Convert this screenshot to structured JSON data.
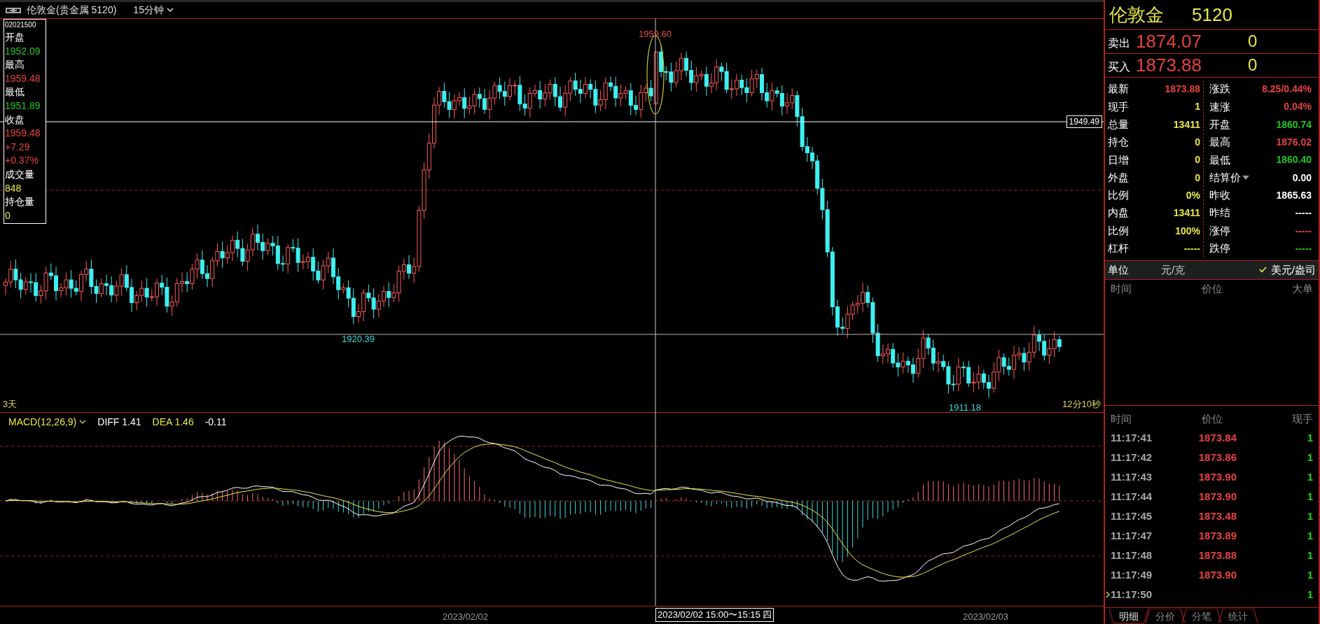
{
  "toolbar": {
    "title": "伦敦金(贵金属 5120)",
    "period": "15分钟"
  },
  "info_box": {
    "time": "02021500",
    "items": [
      {
        "text": "开盘",
        "kind": "label"
      },
      {
        "text": "1952.09",
        "kind": "value",
        "color": "#22c422"
      },
      {
        "text": "最高",
        "kind": "label"
      },
      {
        "text": "1959.48",
        "kind": "value",
        "color": "#e84040"
      },
      {
        "text": "最低",
        "kind": "label"
      },
      {
        "text": "1951.89",
        "kind": "value",
        "color": "#22c422"
      },
      {
        "text": "收盘",
        "kind": "label"
      },
      {
        "text": "1959.48",
        "kind": "value",
        "color": "#e84040"
      },
      {
        "text": "+7.29",
        "kind": "value",
        "color": "#e84040"
      },
      {
        "text": "+0.37%",
        "kind": "value",
        "color": "#e84040"
      },
      {
        "text": "成交量",
        "kind": "label"
      },
      {
        "text": "848",
        "kind": "value",
        "color": "#e8e84a"
      },
      {
        "text": "持仓量",
        "kind": "label"
      },
      {
        "text": "0",
        "kind": "value",
        "color": "#e8e84a"
      }
    ]
  },
  "chart": {
    "price_labels": [
      {
        "text": "1959.60",
        "kind": "high"
      },
      {
        "text": "1920.39",
        "kind": "low"
      },
      {
        "text": "1911.18",
        "kind": "low"
      }
    ],
    "crosshair_price": "1949.49",
    "range": "3天",
    "countdown": "12分10秒"
  },
  "macd": {
    "name": "MACD(12,26,9)",
    "diff": "DIFF 1.41",
    "dea": "DEA 1.46",
    "value": "-0.11"
  },
  "x_axis": {
    "dates": [
      "2023/02/02",
      "2023/02/03"
    ],
    "crosshair_time": "2023/02/02 15:00〜15:15 四"
  },
  "quote": {
    "name": "伦敦金",
    "code": "5120",
    "sell": {
      "label": "卖出",
      "price": "1874.07",
      "volume": "0"
    },
    "buy": {
      "label": "买入",
      "price": "1873.88",
      "volume": "0"
    },
    "stats_left": [
      {
        "label": "最新",
        "value": "1873.88",
        "color": "#e84040"
      },
      {
        "label": "现手",
        "value": "1",
        "color": "#e8e84a"
      },
      {
        "label": "总量",
        "value": "13411",
        "color": "#e8e84a"
      },
      {
        "label": "持仓",
        "value": "0",
        "color": "#e8e84a"
      },
      {
        "label": "日增",
        "value": "0",
        "color": "#e8e84a"
      },
      {
        "label": "外盘",
        "value": "0",
        "color": "#e8e84a"
      },
      {
        "label": "比例",
        "value": "0%",
        "color": "#e8e84a"
      },
      {
        "label": "内盘",
        "value": "13411",
        "color": "#e8e84a"
      },
      {
        "label": "比例",
        "value": "100%",
        "color": "#e8e84a"
      },
      {
        "label": "杠杆",
        "value": "-----",
        "color": "#e8e84a"
      }
    ],
    "stats_right": [
      {
        "label": "涨跌",
        "value": "8.25/0.44%",
        "color": "#e84040",
        "menu": false
      },
      {
        "label": "速涨",
        "value": "0.04%",
        "color": "#e84040",
        "menu": false
      },
      {
        "label": "开盘",
        "value": "1860.74",
        "color": "#22c422",
        "menu": false
      },
      {
        "label": "最高",
        "value": "1876.02",
        "color": "#e84040",
        "menu": false
      },
      {
        "label": "最低",
        "value": "1860.40",
        "color": "#22c422",
        "menu": false
      },
      {
        "label": "结算价",
        "value": "0.00",
        "color": "#ffffff",
        "menu": true
      },
      {
        "label": "昨收",
        "value": "1865.63",
        "color": "#ffffff",
        "menu": false
      },
      {
        "label": "昨结",
        "value": "-----",
        "color": "#ffffff",
        "menu": false
      },
      {
        "label": "涨停",
        "value": "-----",
        "color": "#e84040",
        "menu": false
      },
      {
        "label": "跌停",
        "value": "-----",
        "color": "#22c422",
        "menu": false
      }
    ]
  },
  "unit": {
    "label": "单位",
    "options": [
      {
        "text": "元/克",
        "selected": false
      },
      {
        "text": "美元/盎司",
        "selected": true
      }
    ]
  },
  "big_orders": {
    "columns": [
      "时间",
      "价位",
      "大单"
    ]
  },
  "trades": {
    "columns": [
      "时间",
      "价位",
      "现手"
    ],
    "rows": [
      {
        "time": "11:17:41",
        "price": "1873.84",
        "volume": "1",
        "current": false
      },
      {
        "time": "11:17:42",
        "price": "1873.86",
        "volume": "1",
        "current": false
      },
      {
        "time": "11:17:43",
        "price": "1873.90",
        "volume": "1",
        "current": false
      },
      {
        "time": "11:17:44",
        "price": "1873.90",
        "volume": "1",
        "current": false
      },
      {
        "time": "11:17:45",
        "price": "1873.48",
        "volume": "1",
        "current": false
      },
      {
        "time": "11:17:47",
        "price": "1873.89",
        "volume": "1",
        "current": false
      },
      {
        "time": "11:17:48",
        "price": "1873.88",
        "volume": "1",
        "current": false
      },
      {
        "time": "11:17:49",
        "price": "1873.90",
        "volume": "1",
        "current": false
      },
      {
        "time": "11:17:50",
        "volume": "1",
        "current": true
      }
    ]
  },
  "tabs": [
    {
      "label": "明细",
      "selected": true
    },
    {
      "label": "分价",
      "selected": false
    },
    {
      "label": "分笔",
      "selected": false
    },
    {
      "label": "统计",
      "selected": false
    }
  ]
}
